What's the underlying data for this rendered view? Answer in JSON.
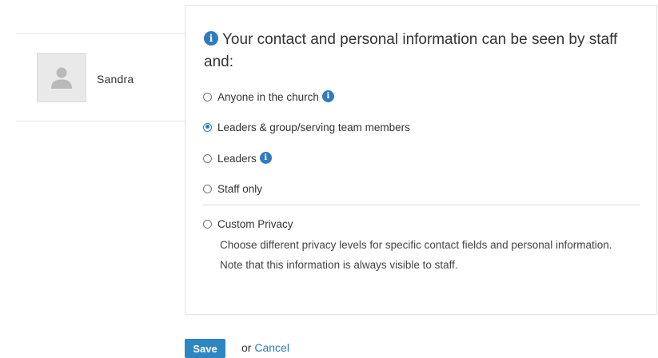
{
  "profile": {
    "name": "Sandra",
    "avatar_icon": "user-silhouette-icon"
  },
  "privacy": {
    "heading_line": "Your contact and personal information can be seen by staff and:",
    "heading_icon": "info-icon",
    "options": [
      {
        "label": "Anyone in the church",
        "selected": false,
        "has_info_icon": true
      },
      {
        "label": "Leaders & group/serving team members",
        "selected": true,
        "has_info_icon": false
      },
      {
        "label": "Leaders",
        "selected": false,
        "has_info_icon": true
      },
      {
        "label": "Staff only",
        "selected": false,
        "has_info_icon": false
      },
      {
        "label": "Custom Privacy",
        "selected": false,
        "has_info_icon": false
      }
    ],
    "custom_description": "Choose different privacy levels for specific contact fields and personal information. Note that this information is always visible to staff."
  },
  "actions": {
    "save_label": "Save",
    "or_label": "or",
    "cancel_label": "Cancel"
  },
  "colors": {
    "accent": "#2f7bbd",
    "save_button": "#2e86c1"
  }
}
